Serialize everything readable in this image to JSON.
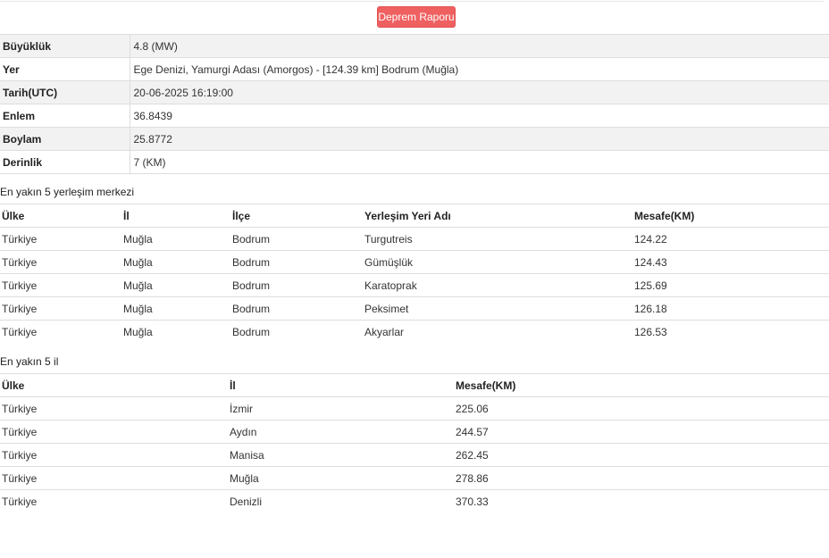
{
  "report_button": "Deprem Raporu",
  "info": [
    {
      "key": "Büyüklük",
      "value": "4.8 (MW)"
    },
    {
      "key": "Yer",
      "value": "Ege Denizi, Yamurgi Adası (Amorgos) - [124.39 km] Bodrum (Muğla)"
    },
    {
      "key": "Tarih(UTC)",
      "value": "20-06-2025 16:19:00"
    },
    {
      "key": "Enlem",
      "value": "36.8439"
    },
    {
      "key": "Boylam",
      "value": "25.8772"
    },
    {
      "key": "Derinlik",
      "value": "7 (KM)"
    }
  ],
  "settlements": {
    "caption": "En yakın 5 yerleşim merkezi",
    "headers": [
      "Ülke",
      "İl",
      "İlçe",
      "Yerleşim Yeri Adı",
      "Mesafe(KM)"
    ],
    "rows": [
      [
        "Türkiye",
        "Muğla",
        "Bodrum",
        "Turgutreis",
        "124.22"
      ],
      [
        "Türkiye",
        "Muğla",
        "Bodrum",
        "Gümüşlük",
        "124.43"
      ],
      [
        "Türkiye",
        "Muğla",
        "Bodrum",
        "Karatoprak",
        "125.69"
      ],
      [
        "Türkiye",
        "Muğla",
        "Bodrum",
        "Peksimet",
        "126.18"
      ],
      [
        "Türkiye",
        "Muğla",
        "Bodrum",
        "Akyarlar",
        "126.53"
      ]
    ]
  },
  "provinces": {
    "caption": "En yakın 5 il",
    "headers": [
      "Ülke",
      "İl",
      "Mesafe(KM)"
    ],
    "rows": [
      [
        "Türkiye",
        "İzmir",
        "225.06"
      ],
      [
        "Türkiye",
        "Aydın",
        "244.57"
      ],
      [
        "Türkiye",
        "Manisa",
        "262.45"
      ],
      [
        "Türkiye",
        "Muğla",
        "278.86"
      ],
      [
        "Türkiye",
        "Denizli",
        "370.33"
      ]
    ]
  },
  "colors": {
    "button": "#ef6060",
    "shade": "#f2f2f2",
    "border": "#dddddd"
  }
}
